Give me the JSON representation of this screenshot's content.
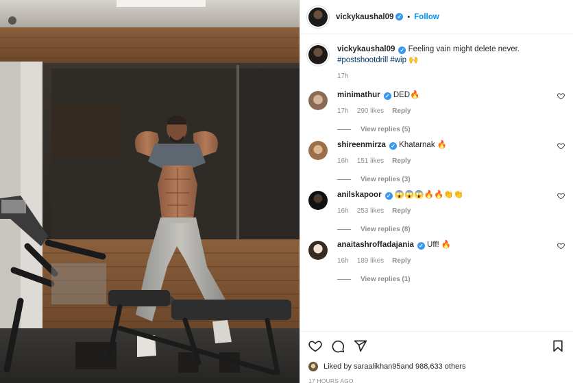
{
  "post": {
    "author": "vickykaushal09",
    "follow_label": "Follow",
    "dot": "•",
    "caption": {
      "username": "vickykaushal09",
      "text": "Feeling vain might delete never.",
      "hashtag1": "#postshootdrill",
      "hashtag2": "#wip",
      "emoji": "🙌",
      "time": "17h"
    }
  },
  "comments": [
    {
      "username": "minimathur",
      "text": "DED🔥",
      "time": "17h",
      "likes": "290 likes",
      "reply": "Reply",
      "view_replies": "View replies (5)"
    },
    {
      "username": "shireenmirza",
      "text": "Khatarnak 🔥",
      "time": "16h",
      "likes": "151 likes",
      "reply": "Reply",
      "view_replies": "View replies (3)"
    },
    {
      "username": "anilskapoor",
      "text": "😱😱😱🔥🔥👏👏",
      "time": "16h",
      "likes": "253 likes",
      "reply": "Reply",
      "view_replies": "View replies (8)"
    },
    {
      "username": "anaitashroffadajania",
      "text": "Uff! 🔥",
      "time": "16h",
      "likes": "189 likes",
      "reply": "Reply",
      "view_replies": "View replies (1)"
    }
  ],
  "footer": {
    "liked_by_prefix": "Liked by ",
    "liked_by_user": "saraalikhan95",
    "liked_by_suffix": " and 988,633 others",
    "timestamp": "17 HOURS AGO"
  },
  "icons": {
    "like": "heart-icon",
    "comment": "comment-icon",
    "share": "share-icon",
    "save": "bookmark-icon"
  },
  "colors": {
    "link": "#0095f6",
    "verified": "#3897f0",
    "muted": "#8e8e8e"
  }
}
